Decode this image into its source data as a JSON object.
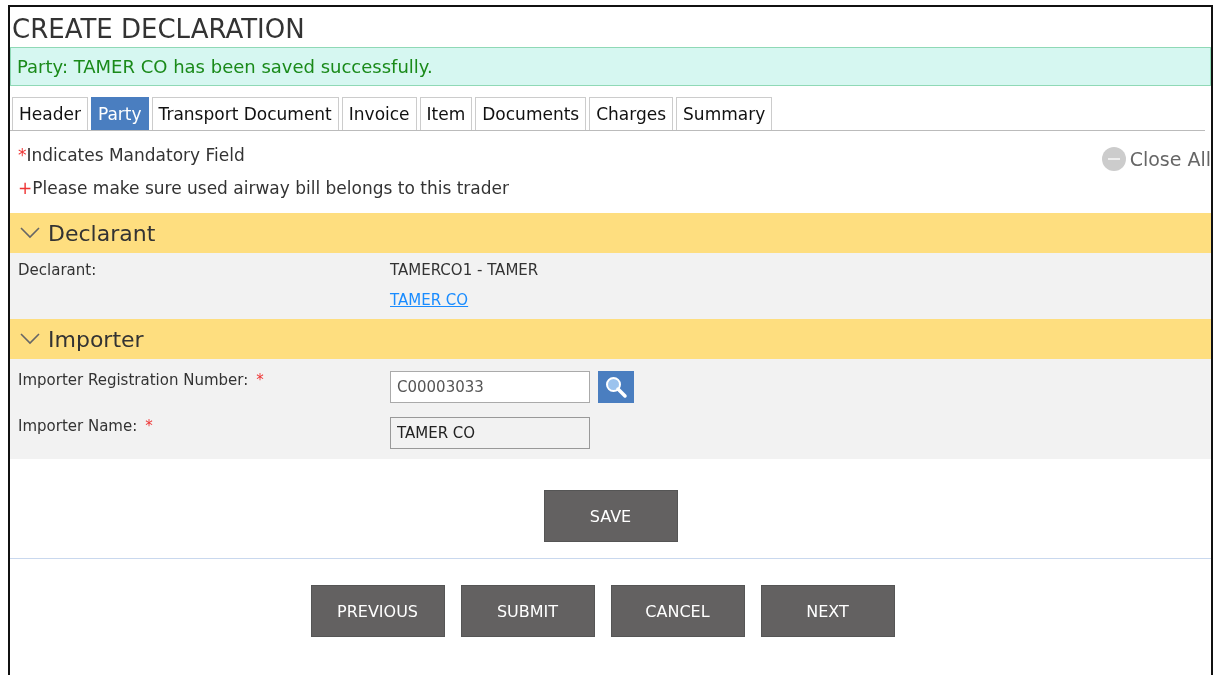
{
  "title": "CREATE DECLARATION",
  "message": "Party: TAMER CO has been saved successfully.",
  "tabs": [
    {
      "label": "Header",
      "selected": false
    },
    {
      "label": "Party",
      "selected": true
    },
    {
      "label": "Transport Document",
      "selected": false
    },
    {
      "label": "Invoice",
      "selected": false
    },
    {
      "label": "Item",
      "selected": false
    },
    {
      "label": "Documents",
      "selected": false
    },
    {
      "label": "Charges",
      "selected": false
    },
    {
      "label": "Summary",
      "selected": false
    }
  ],
  "notes": [
    {
      "marker": "*",
      "text": "Indicates Mandatory Field"
    },
    {
      "marker": "+",
      "text": "Please make sure used airway bill belongs to this trader"
    }
  ],
  "close_all": "Close All",
  "sections": [
    {
      "title": "Declarant",
      "expanded": true,
      "fields": [
        {
          "kind": "text",
          "label": "Declarant:",
          "required": false,
          "value": "TAMERCO1 - TAMER",
          "link": "TAMER CO"
        }
      ]
    },
    {
      "title": "Importer",
      "expanded": true,
      "fields": [
        {
          "kind": "lookup",
          "label": "Importer Registration Number:",
          "required": true,
          "value": "C00003033"
        },
        {
          "kind": "readonly",
          "label": "Importer Name:",
          "required": true,
          "value": "TAMER CO"
        }
      ]
    }
  ],
  "save_button": "SAVE",
  "nav_buttons": [
    "PREVIOUS",
    "SUBMIT",
    "CANCEL",
    "NEXT"
  ]
}
